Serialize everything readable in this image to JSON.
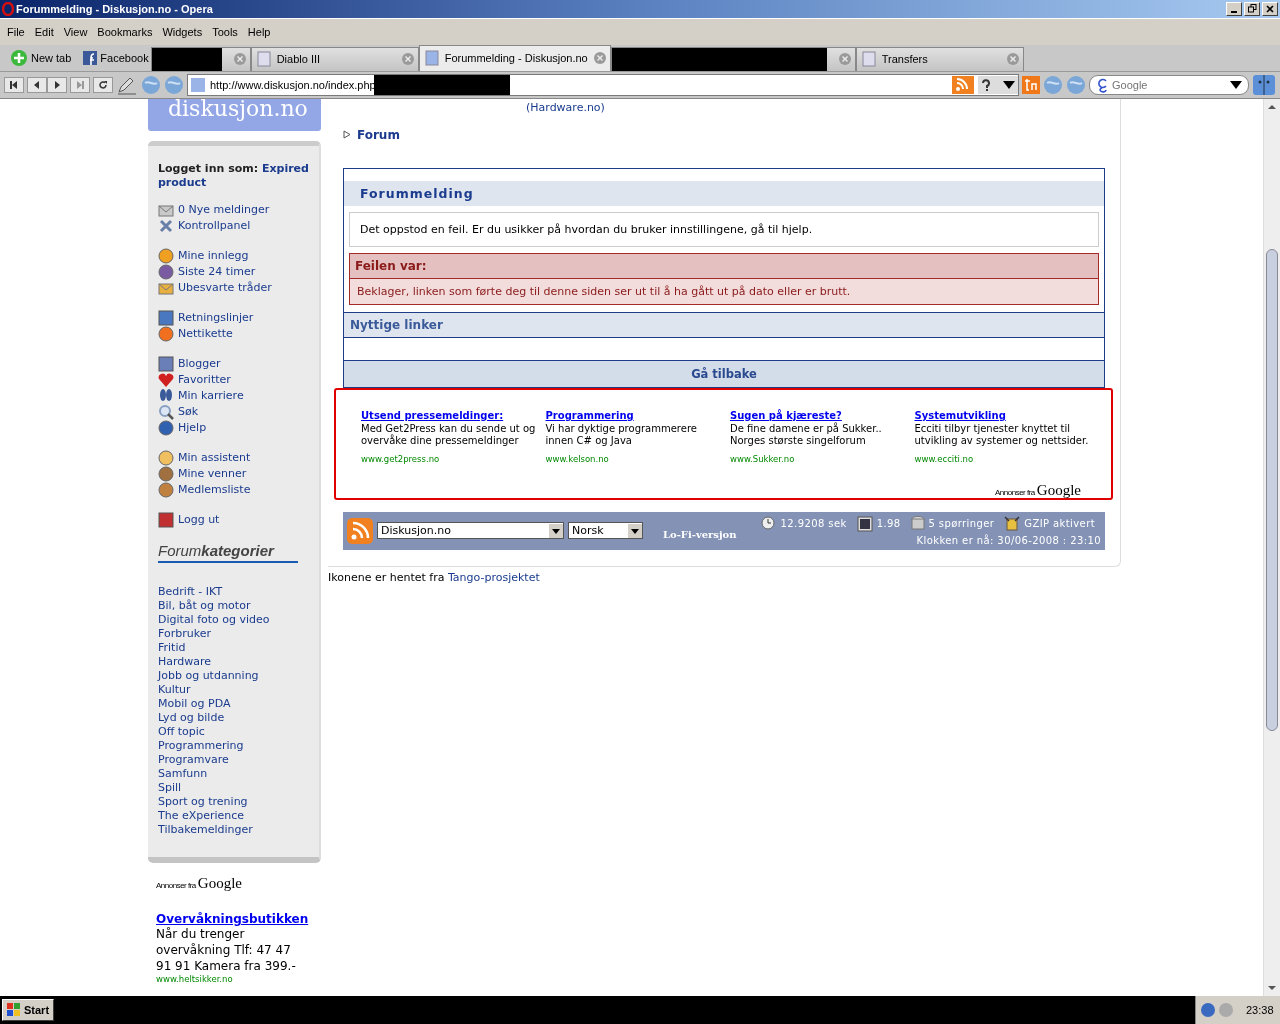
{
  "window": {
    "title": "Forummelding - Diskusjon.no - Opera"
  },
  "menu": [
    "File",
    "Edit",
    "View",
    "Bookmarks",
    "Widgets",
    "Tools",
    "Help"
  ],
  "quick_links": [
    "New tab",
    "Facebook"
  ],
  "tabs": [
    {
      "kind": "redacted",
      "selected": false
    },
    {
      "kind": "normal",
      "label": "Diablo III",
      "selected": false
    },
    {
      "kind": "normal",
      "label": "Forummelding - Diskusjon.no",
      "selected": true
    },
    {
      "kind": "redacted",
      "selected": false
    },
    {
      "kind": "normal",
      "label": "Transfers",
      "selected": false
    }
  ],
  "address": {
    "value": "http://www.diskusjon.no/index.php"
  },
  "search": {
    "placeholder": "Google"
  },
  "sidebar": {
    "logo": "diskusjon.no",
    "logged_in_label": "Logget inn som:",
    "user": "Expired product",
    "groups": [
      {
        "items": [
          "0 Nye meldinger",
          "Kontrollpanel"
        ]
      },
      {
        "items": [
          "Mine innlegg",
          "Siste 24 timer",
          "Ubesvarte tråder"
        ]
      },
      {
        "items": [
          "Retningslinjer",
          "Nettikette"
        ]
      },
      {
        "items": [
          "Blogger",
          "Favoritter",
          "Min karriere",
          "Søk",
          "Hjelp"
        ]
      },
      {
        "items": [
          "Min assistent",
          "Mine venner",
          "Medlemsliste"
        ]
      },
      {
        "items": [
          "Logg ut"
        ]
      }
    ],
    "categories_title": "Forum",
    "categories_title_bold": "kategorier",
    "categories": [
      "Bedrift - IKT",
      "Bil, båt og motor",
      "Digital foto og video",
      "Forbruker",
      "Fritid",
      "Hardware",
      "Jobb og utdanning",
      "Kultur",
      "Mobil og PDA",
      "Lyd og bilde",
      "Off topic",
      "Programmering",
      "Programvare",
      "Samfunn",
      "Spill",
      "Sport og trening",
      "The eXperience",
      "Tilbakemeldinger"
    ],
    "ad_label": "Annonser fra",
    "ad_brand": "Google",
    "ad": {
      "title": "Overvåkningsbutikken",
      "text": "Når du trenger overvåkning Tlf: 47 47 91 91 Kamera fra 399.-",
      "url": "www.heltsikker.no"
    }
  },
  "main": {
    "top_link": "(Hardware.no)",
    "breadcrumb": "Forum",
    "panel_title": "Forummelding",
    "info": "Det oppstod en feil. Er du usikker på hvordan du bruker innstillingene, gå til hjelp.",
    "error_title": "Feilen var:",
    "error_text": "Beklager, linken som førte deg til denne siden ser ut til å ha gått ut på dato eller er brutt.",
    "links_title": "Nyttige linker",
    "back_button": "Gå tilbake",
    "ads": [
      {
        "title": "Utsend pressemeldinger:",
        "text": "Med Get2Press kan du sende ut og overvåke dine pressemeldinger",
        "url": "www.get2press.no"
      },
      {
        "title": "Programmering",
        "text": "Vi har dyktige programmerere innen C# og Java",
        "url": "www.kelson.no"
      },
      {
        "title": "Sugen på kjæreste?",
        "text": "De fine damene er på Sukker.. Norges største singelforum",
        "url": "www.Sukker.no"
      },
      {
        "title": "Systemutvikling",
        "text": "Ecciti tilbyr tjenester knyttet til utvikling av systemer og nettsider.",
        "url": "www.ecciti.no"
      }
    ],
    "ad_label": "Annonser fra",
    "ad_brand": "Google",
    "footer": {
      "site_select": "Diskusjon.no",
      "lang_select": "Norsk",
      "lofi": "Lo-Fi-versjon",
      "time": "12.9208 sek",
      "load": "1.98",
      "queries": "5 spørringer",
      "gzip": "GZIP aktivert",
      "clock": "Klokken er nå: 30/06-2008 : 23:10"
    },
    "credits": "Ikonene er hentet fra",
    "credits_link": "Tango-prosjektet"
  },
  "taskbar": {
    "start": "Start",
    "clock": "23:38"
  }
}
